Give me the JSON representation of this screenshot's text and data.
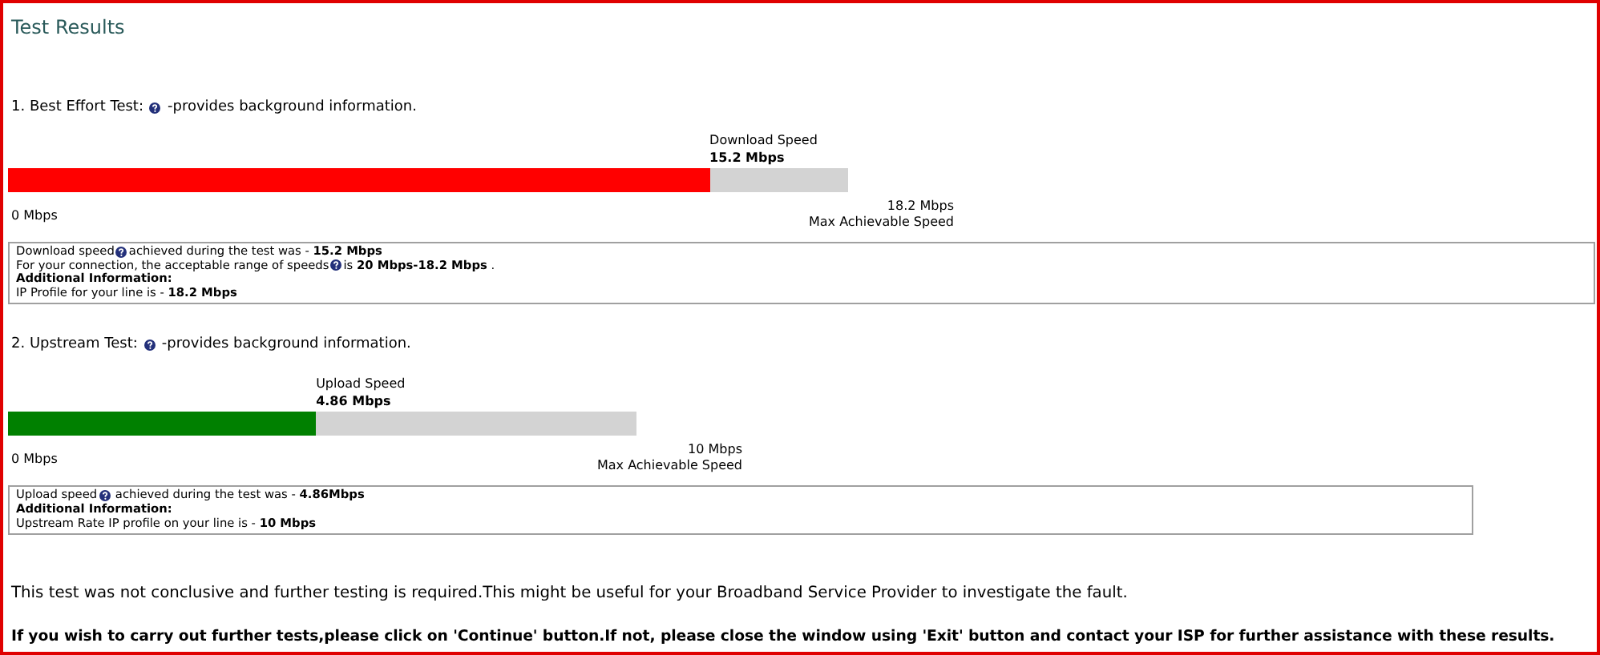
{
  "title": "Test Results",
  "tests": [
    {
      "heading": "1. Best Effort Test:",
      "heading_note": "-provides background information.",
      "speed_label": "Download Speed",
      "speed_value": "15.2 Mbps",
      "level": 0.835,
      "color": "#ff0000",
      "min_label": "0 Mbps",
      "max_value": "18.2 Mbps",
      "max_label": "Max Achievable Speed",
      "info": [
        {
          "kind": "help",
          "text": "Download speed",
          "rest": "achieved during the test was - **15.2 Mbps**"
        },
        {
          "kind": "help",
          "text": "For your connection, the acceptable range of speeds",
          "rest": "is **20 Mbps-18.2 Mbps** ."
        },
        {
          "kind": "heading",
          "text": "Additional Information:"
        },
        {
          "kind": "plain",
          "text": "IP Profile for your line is - **18.2 Mbps**"
        }
      ]
    },
    {
      "heading": "2. Upstream Test:",
      "heading_note": "-provides background information.",
      "speed_label": "Upload Speed",
      "speed_value": "4.86 Mbps",
      "level": 0.49,
      "color": "#008000",
      "min_label": "0 Mbps",
      "max_value": "10 Mbps",
      "max_label": "Max Achievable Speed",
      "info": [
        {
          "kind": "help",
          "text": "Upload speed",
          "rest": " achieved during the test was - **4.86Mbps**"
        },
        {
          "kind": "heading",
          "text": "Additional Information:"
        },
        {
          "kind": "plain",
          "text": "Upstream Rate IP profile on your line is - **10 Mbps**"
        }
      ]
    }
  ],
  "conclusion": "This test was not conclusive and further testing is required.This might be useful for your Broadband Service Provider to investigate the fault.",
  "instruction": "If you wish to carry out further tests,please click on 'Continue' button.If not, please close the window using 'Exit' button and contact your ISP for further assistance with these results."
}
